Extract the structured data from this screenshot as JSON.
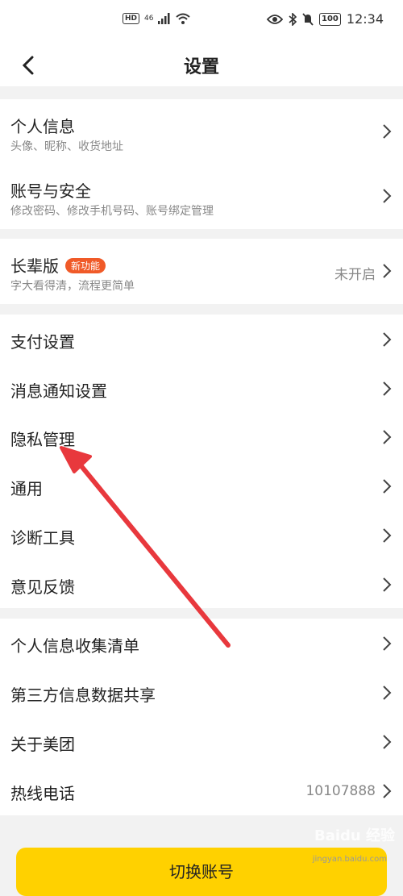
{
  "status_bar": {
    "network": "46",
    "hd": "HD",
    "battery": "100",
    "time": "12:34"
  },
  "header": {
    "title": "设置"
  },
  "sections": [
    {
      "items": [
        {
          "label": "个人信息",
          "sub": "头像、昵称、收货地址"
        },
        {
          "label": "账号与安全",
          "sub": "修改密码、修改手机号码、账号绑定管理"
        }
      ]
    },
    {
      "items": [
        {
          "label": "长辈版",
          "badge": "新功能",
          "sub": "字大看得清，流程更简单",
          "value": "未开启"
        }
      ]
    },
    {
      "items": [
        {
          "label": "支付设置"
        },
        {
          "label": "消息通知设置"
        },
        {
          "label": "隐私管理"
        },
        {
          "label": "通用"
        },
        {
          "label": "诊断工具"
        },
        {
          "label": "意见反馈"
        }
      ]
    },
    {
      "items": [
        {
          "label": "个人信息收集清单"
        },
        {
          "label": "第三方信息数据共享"
        },
        {
          "label": "关于美团"
        },
        {
          "label": "热线电话",
          "value": "10107888"
        }
      ]
    }
  ],
  "bottom_button": {
    "label": "切换账号"
  },
  "watermark": {
    "text": "Baidu 经验",
    "sub": "jingyan.baidu.com"
  },
  "colors": {
    "accent": "#ffd100",
    "badge": "#f05a28",
    "arrow": "#e8383d"
  }
}
